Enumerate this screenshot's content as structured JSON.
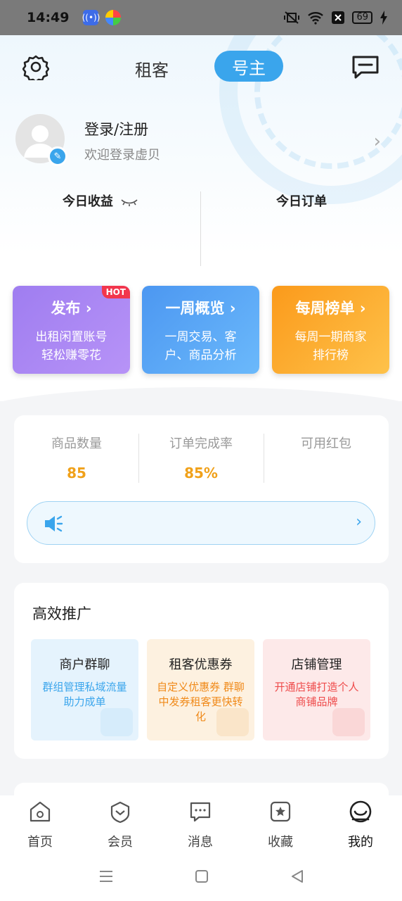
{
  "status_bar": {
    "time": "14:49",
    "battery": "69",
    "icons": [
      "nfc-app-icon",
      "colorful-app-icon",
      "vibrate-icon",
      "wifi-icon",
      "sim-off-icon",
      "battery-icon",
      "charging-icon"
    ]
  },
  "top_nav": {
    "settings_icon": "gear-icon",
    "tab_renter": "租客",
    "tab_owner": "号主",
    "message_icon": "message-icon"
  },
  "profile": {
    "title": "登录/注册",
    "subtitle": "欢迎登录虚贝"
  },
  "today": {
    "income_label": "今日收益",
    "orders_label": "今日订单"
  },
  "feature_cards": [
    {
      "title": "发布",
      "desc_line1": "出租闲置账号",
      "desc_line2": "轻松赚零花",
      "badge": "HOT"
    },
    {
      "title": "一周概览",
      "desc_line1": "一周交易、客",
      "desc_line2": "户、商品分析"
    },
    {
      "title": "每周榜单",
      "desc_line1": "每周一期商家",
      "desc_line2": "排行榜"
    }
  ],
  "shop_stats": [
    {
      "label": "商品数量",
      "value": "85"
    },
    {
      "label": "订单完成率",
      "value": "85%"
    },
    {
      "label": "可用红包",
      "value": ""
    }
  ],
  "promo": {
    "title": "高效推广",
    "items": [
      {
        "title": "商户群聊",
        "desc": "群组管理私域流量助力成单"
      },
      {
        "title": "租客优惠券",
        "desc": "自定义优惠券 群聊中发券租客更快转化"
      },
      {
        "title": "店铺管理",
        "desc": "开通店铺打造个人商铺品牌"
      }
    ]
  },
  "tab_bar": [
    {
      "label": "首页",
      "icon": "home-icon"
    },
    {
      "label": "会员",
      "icon": "member-icon"
    },
    {
      "label": "消息",
      "icon": "chat-icon"
    },
    {
      "label": "收藏",
      "icon": "favorite-icon"
    },
    {
      "label": "我的",
      "icon": "profile-icon",
      "active": true
    }
  ],
  "colors": {
    "accent": "#3aa5ec",
    "value_orange": "#f0a11a",
    "card_purple": "#a985f3",
    "card_blue": "#57a6f5",
    "card_orange": "#fca92e"
  }
}
